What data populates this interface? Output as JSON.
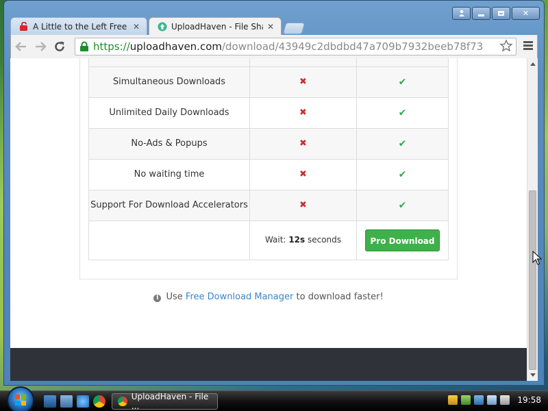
{
  "browser": {
    "tabs": [
      {
        "title": "A Little to the Left Free Do",
        "active": false
      },
      {
        "title": "UploadHaven - File Sharin",
        "active": true
      }
    ],
    "url": {
      "scheme": "https://",
      "host": "uploadhaven.com",
      "path": "/download/43949c2dbdbd47a709b7932beeb78f73"
    }
  },
  "comparison": {
    "rows": [
      {
        "feature": "Simultaneous Downloads",
        "free": "cross-icon",
        "pro": "check-icon"
      },
      {
        "feature": "Unlimited Daily Downloads",
        "free": "cross-icon",
        "pro": "check-icon"
      },
      {
        "feature": "No-Ads & Popups",
        "free": "cross-icon",
        "pro": "check-icon"
      },
      {
        "feature": "No waiting time",
        "free": "cross-icon",
        "pro": "check-icon"
      },
      {
        "feature": "Support For Download Accelerators",
        "free": "cross-icon",
        "pro": "check-icon"
      }
    ],
    "cross_glyph": "✖",
    "check_glyph": "✔",
    "wait_prefix": "Wait:",
    "wait_value": "12s",
    "wait_suffix": "seconds",
    "pro_button": "Pro Download"
  },
  "tip": {
    "prefix": "Use",
    "link": "Free Download Manager",
    "suffix": "to download faster!"
  },
  "taskbar": {
    "task_label": "UploadHaven - File ...",
    "clock": "19:58"
  },
  "colors": {
    "pro_button": "#3fb14a",
    "check": "#2fa84f",
    "cross": "#c9302c",
    "link": "#3a86c8",
    "footer": "#2f3339"
  }
}
